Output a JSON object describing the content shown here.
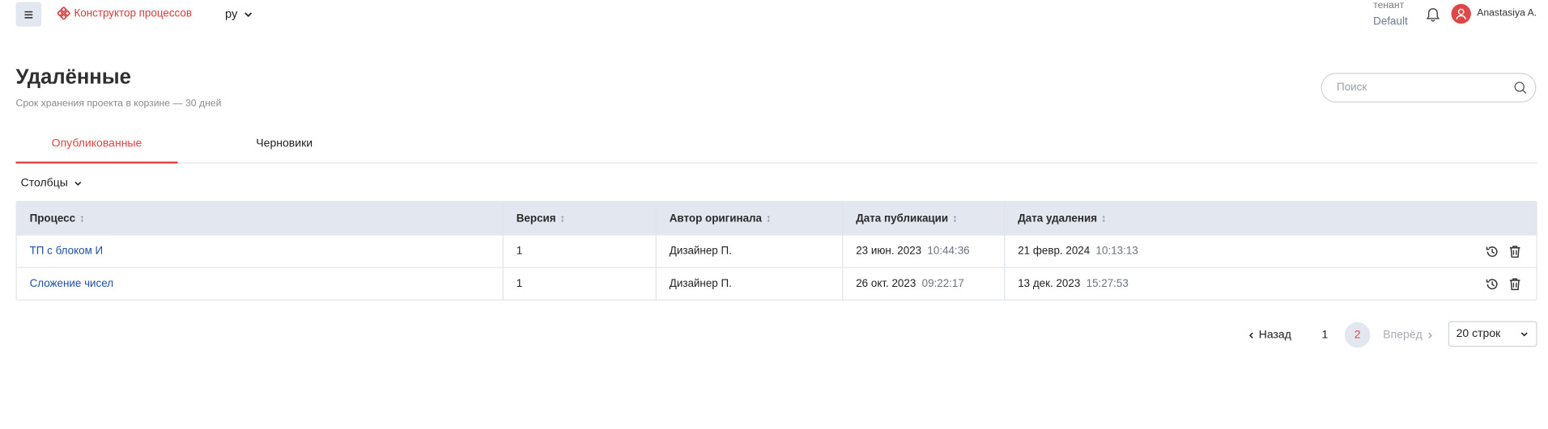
{
  "header": {
    "app_name": "Конструктор процессов",
    "language": "ру",
    "tenant_label": "тенант",
    "tenant_value": "Default",
    "user_name": "Anastasiya A."
  },
  "page": {
    "title": "Удалённые",
    "subtitle": "Срок хранения проекта в корзине — 30 дней"
  },
  "search": {
    "placeholder": "Поиск"
  },
  "tabs": [
    {
      "label": "Опубликованные",
      "active": true
    },
    {
      "label": "Черновики",
      "active": false
    }
  ],
  "columns_button": "Столбцы",
  "table": {
    "headers": [
      "Процесс",
      "Версия",
      "Автор оригинала",
      "Дата публикации",
      "Дата удаления"
    ],
    "rows": [
      {
        "process": "ТП с блоком И",
        "version": "1",
        "author": "Дизайнер П.",
        "published_date": "23 июн. 2023",
        "published_time": "10:44:36",
        "deleted_date": "21 февр. 2024",
        "deleted_time": "10:13:13"
      },
      {
        "process": "Сложение чисел",
        "version": "1",
        "author": "Дизайнер П.",
        "published_date": "26 окт. 2023",
        "published_time": "09:22:17",
        "deleted_date": "13 дек. 2023",
        "deleted_time": "15:27:53"
      }
    ]
  },
  "pagination": {
    "prev_label": "Назад",
    "next_label": "Вперёд",
    "pages": [
      "1",
      "2"
    ],
    "current_page": "2",
    "rows_per_page": "20 строк"
  },
  "colors": {
    "accent": "#e04646",
    "link": "#1f4fa8",
    "table_header_bg": "#e3e8f0"
  }
}
